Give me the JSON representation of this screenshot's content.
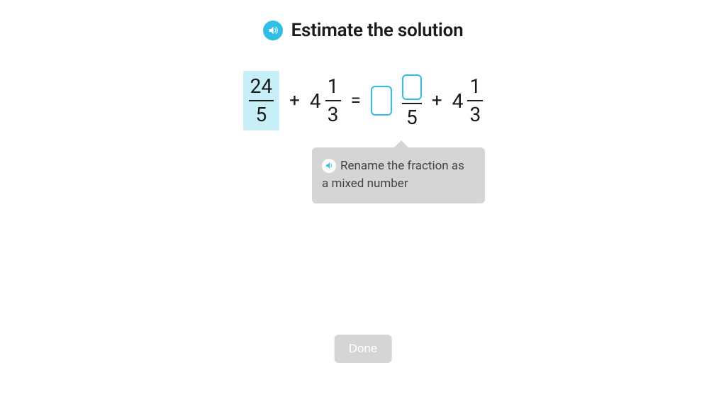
{
  "header": {
    "title": "Estimate the solution"
  },
  "equation": {
    "left_fraction": {
      "num": "24",
      "den": "5"
    },
    "plus1": "+",
    "mixed1": {
      "whole": "4",
      "num": "1",
      "den": "3"
    },
    "equals": "=",
    "answer_fraction_den": "5",
    "plus2": "+",
    "mixed2": {
      "whole": "4",
      "num": "1",
      "den": "3"
    }
  },
  "tooltip": {
    "text": "Rename the fraction as a mixed number"
  },
  "buttons": {
    "done": "Done"
  }
}
